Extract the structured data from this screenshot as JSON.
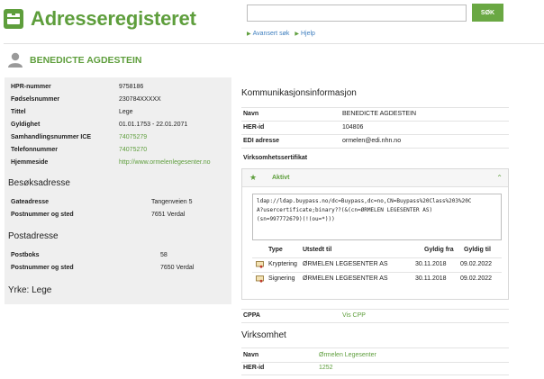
{
  "app": {
    "title": "Adresseregisteret",
    "brand_color": "#5e9e3c"
  },
  "search": {
    "value": "",
    "placeholder": "",
    "button_label": "SØK",
    "links": [
      "Avansert søk",
      "Hjelp"
    ]
  },
  "person": {
    "name": "BENEDICTE AGDESTEIN"
  },
  "details": [
    {
      "key": "HPR-nummer",
      "value": "9758186",
      "link": false
    },
    {
      "key": "Fødselsnummer",
      "value": "230784XXXXX",
      "link": false
    },
    {
      "key": "Tittel",
      "value": "Lege",
      "link": false
    },
    {
      "key": "Gyldighet",
      "value": "01.01.1753 - 22.01.2071",
      "link": false
    },
    {
      "key": "Samhandlingsnummer ICE",
      "value": "74075279",
      "link": true
    },
    {
      "key": "Telefonnummer",
      "value": "74075270",
      "link": true
    },
    {
      "key": "Hjemmeside",
      "value": "http://www.ormelenlegesenter.no",
      "link": true
    }
  ],
  "visiting_address": {
    "heading": "Besøksadresse",
    "rows": [
      {
        "key": "Gateadresse",
        "value": "Tangenveien 5"
      },
      {
        "key": "Postnummer og sted",
        "value": "7651 Verdal"
      }
    ]
  },
  "postal_address": {
    "heading": "Postadresse",
    "rows": [
      {
        "key": "Postboks",
        "value": "58"
      },
      {
        "key": "Postnummer og sted",
        "value": "7650 Verdal"
      }
    ]
  },
  "occupation": "Yrke: Lege",
  "communication": {
    "heading": "Kommunikasjonsinformasjon",
    "rows": [
      {
        "key": "Navn",
        "value": "BENEDICTE AGDESTEIN"
      },
      {
        "key": "HER-id",
        "value": "104806"
      },
      {
        "key": "EDI adresse",
        "value": "ormelen@edi.nhn.no"
      }
    ]
  },
  "certificate": {
    "heading": "Virksomhetssertifikat",
    "status": "Aktivt",
    "ldap_lines": [
      "ldap://ldap.buypass.no/dc=Buypass,dc=no,CN=Buypass%20Class%203%20C",
      "A?usercertificate;binary??(&(cn=ØRMELEN LEGESENTER AS)",
      "(sn=997772679)(!(ou=*)))"
    ],
    "columns": [
      "Type",
      "Utstedt til",
      "Gyldig fra",
      "Gyldig til"
    ],
    "rows": [
      {
        "type": "Kryptering",
        "issued_to": "ØRMELEN LEGESENTER AS",
        "from": "30.11.2018",
        "to": "09.02.2022"
      },
      {
        "type": "Signering",
        "issued_to": "ØRMELEN LEGESENTER AS",
        "from": "30.11.2018",
        "to": "09.02.2022"
      }
    ]
  },
  "cppa": {
    "key": "CPPA",
    "value": "Vis CPP"
  },
  "organization": {
    "heading": "Virksomhet",
    "rows": [
      {
        "key": "Navn",
        "value": "Ørmelen Legesenter"
      },
      {
        "key": "HER-id",
        "value": "1252"
      }
    ]
  }
}
